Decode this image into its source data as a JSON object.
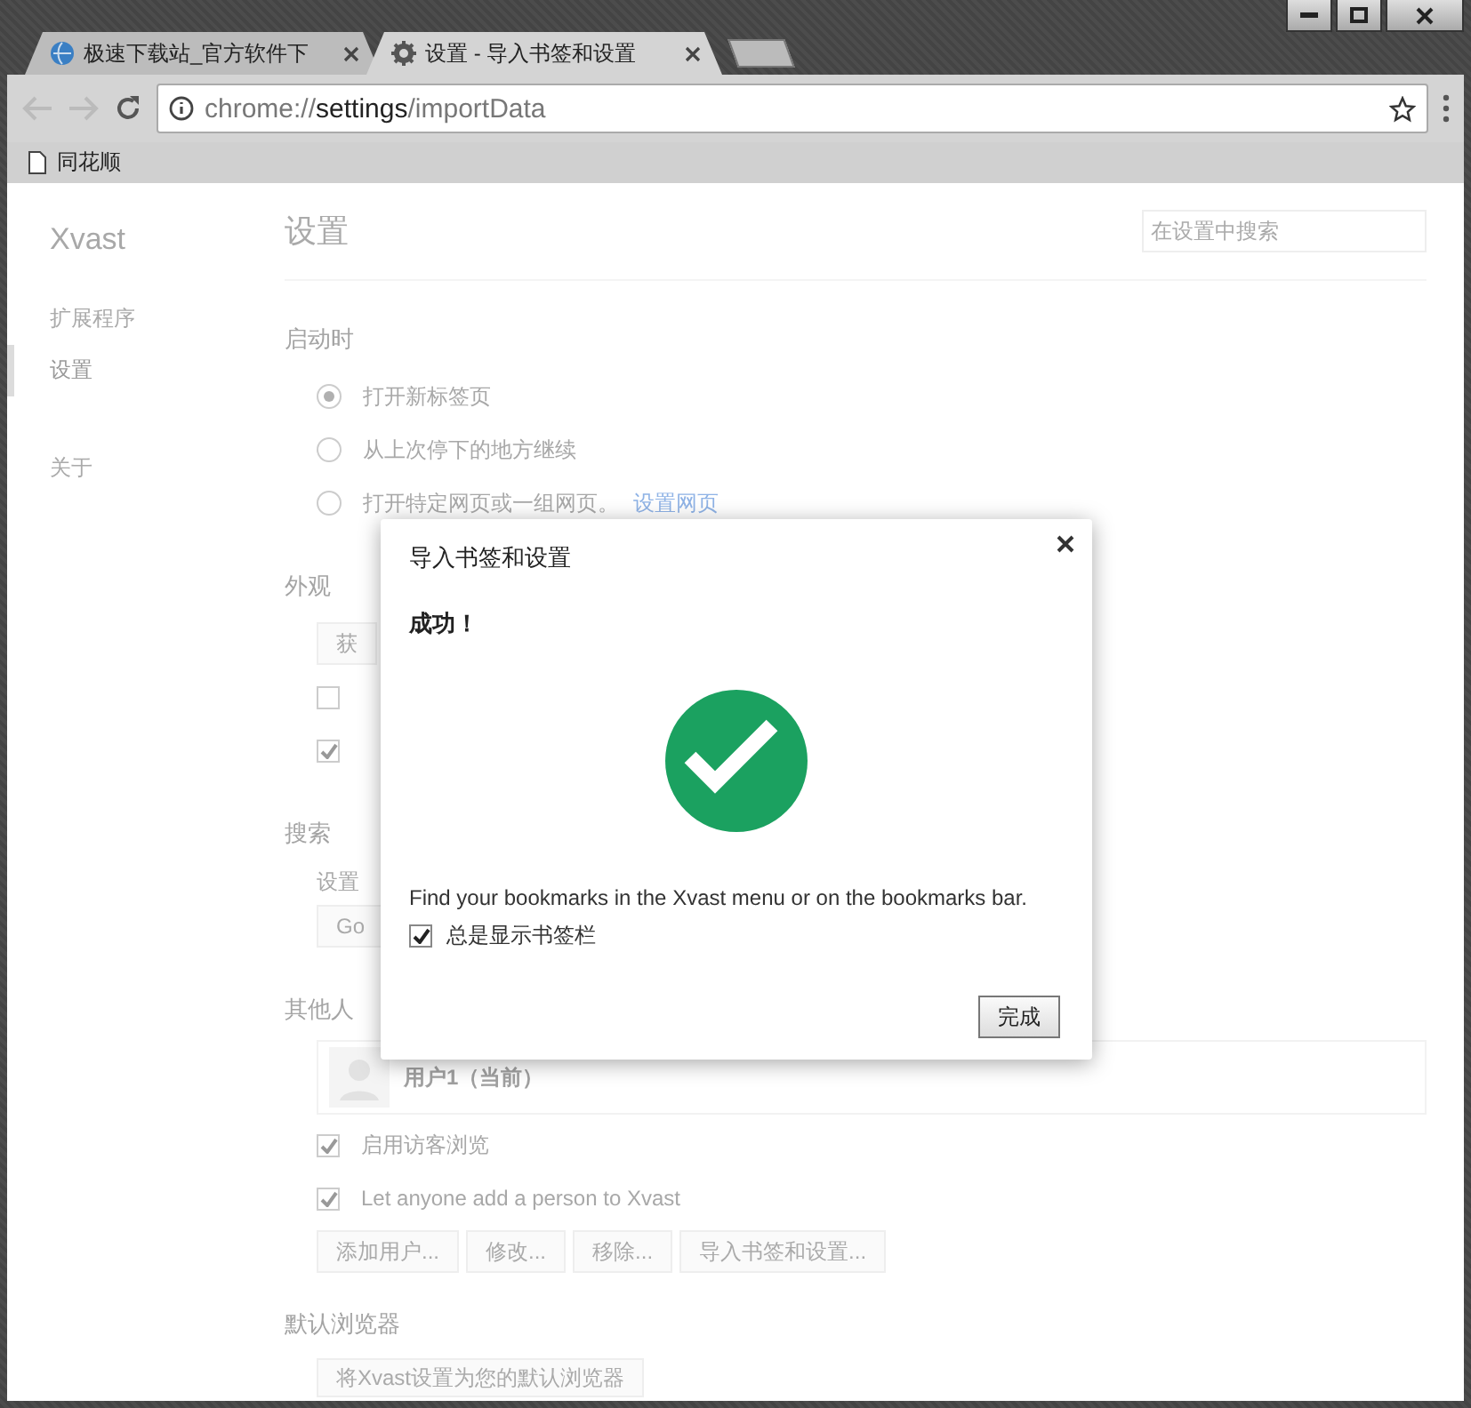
{
  "tabs": [
    {
      "title": "极速下载站_官方软件下",
      "selected": false
    },
    {
      "title": "设置 - 导入书签和设置",
      "selected": true
    }
  ],
  "address_bar": {
    "scheme": "chrome://",
    "host": "settings",
    "path": "/importData"
  },
  "bookmarks": [
    {
      "label": "同花顺"
    }
  ],
  "sidebar": {
    "brand": "Xvast",
    "items": [
      {
        "label": "扩展程序",
        "selected": false
      },
      {
        "label": "设置",
        "selected": true
      },
      {
        "label": "关于",
        "selected": false
      }
    ]
  },
  "page": {
    "title": "设置",
    "search": {
      "placeholder": "在设置中搜索"
    },
    "sections": [
      {
        "heading": "启动时",
        "items": [
          {
            "kind": "radio",
            "label": "打开新标签页",
            "selected": true
          },
          {
            "kind": "radio",
            "label": "从上次停下的地方继续",
            "selected": false
          },
          {
            "kind": "radio",
            "label": "打开特定网页或一组网页。",
            "link": "设置网页",
            "selected": false
          }
        ]
      },
      {
        "heading": "外观",
        "items": [
          {
            "kind": "buttons",
            "buttons": [
              "获"
            ]
          },
          {
            "kind": "checkbox",
            "checked": false
          },
          {
            "kind": "checkbox",
            "checked": true
          }
        ]
      },
      {
        "heading": "搜索",
        "items": [
          {
            "kind": "text",
            "label": "设置"
          },
          {
            "kind": "buttons",
            "buttons": [
              "Go"
            ]
          }
        ]
      },
      {
        "heading": "其他人",
        "items": [
          {
            "kind": "user",
            "label": "用户1（当前）"
          },
          {
            "kind": "checkbox",
            "label": "启用访客浏览",
            "checked": true
          },
          {
            "kind": "checkbox",
            "label": "Let anyone add a person to Xvast",
            "checked": true
          },
          {
            "kind": "buttons",
            "buttons": [
              "添加用户...",
              "修改...",
              "移除...",
              "导入书签和设置..."
            ]
          }
        ]
      },
      {
        "heading": "默认浏览器",
        "items": [
          {
            "kind": "buttons",
            "buttons": [
              "将Xvast设置为您的默认浏览器"
            ]
          }
        ]
      }
    ]
  },
  "dialog": {
    "title": "导入书签和设置",
    "status": "成功！",
    "message": "Find your bookmarks in the Xvast menu or on the bookmarks bar.",
    "checkbox": {
      "label": "总是显示书签栏",
      "checked": true
    },
    "button": "完成"
  }
}
